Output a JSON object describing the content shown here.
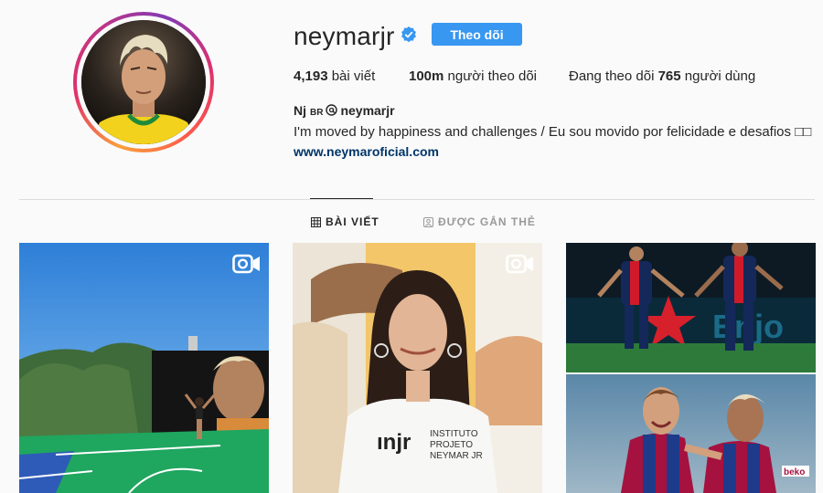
{
  "profile": {
    "username": "neymarjr",
    "verified_icon": "verified-badge-icon",
    "follow_label": "Theo dõi",
    "stats": {
      "posts_count": "4,193",
      "posts_label": "bài viết",
      "followers_count": "100m",
      "followers_label": "người theo dõi",
      "following_prefix": "Đang theo dõi",
      "following_count": "765",
      "following_suffix": "người dùng"
    },
    "bio": {
      "name": "Nj",
      "country_tag": "BR",
      "handle": "neymarjr",
      "text": "I'm moved by happiness and challenges / Eu sou movido por felicidade e desafios □□",
      "link": "www.neymaroficial.com"
    }
  },
  "tabs": [
    {
      "label": "BÀI VIẾT",
      "icon": "grid-icon",
      "active": true
    },
    {
      "label": "ĐƯỢC GẮN THẺ",
      "icon": "tagged-icon",
      "active": false
    }
  ],
  "posts": [
    {
      "type": "video",
      "icon": "video-camera-icon"
    },
    {
      "type": "video",
      "icon": "video-camera-icon",
      "shirt_text": "INSTITUTO PROJETO NEYMAR JR"
    },
    {
      "type": "photo"
    },
    {
      "type": "photo"
    }
  ],
  "colors": {
    "follow_button": "#3897f0",
    "link": "#003569",
    "verified": "#3897f0"
  }
}
